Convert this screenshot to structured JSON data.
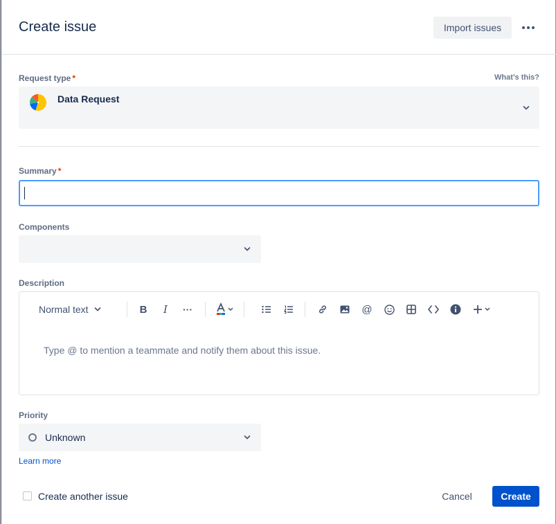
{
  "header": {
    "title": "Create issue",
    "import_label": "Import issues"
  },
  "request_type": {
    "label": "Request type",
    "required": "*",
    "help_link": "What’s this?",
    "value": "Data Request",
    "icon": "pie-chart-icon"
  },
  "summary": {
    "label": "Summary",
    "required": "*",
    "value": ""
  },
  "components": {
    "label": "Components",
    "value": ""
  },
  "description": {
    "label": "Description",
    "text_style": "Normal text",
    "placeholder": "Type @ to mention a teammate and notify them about this issue.",
    "toolbar_icons": [
      "bold-icon",
      "italic-icon",
      "more-formatting-icon",
      "text-color-icon",
      "bullet-list-icon",
      "numbered-list-icon",
      "link-icon",
      "image-icon",
      "mention-icon",
      "emoji-icon",
      "table-icon",
      "code-icon",
      "info-icon",
      "insert-plus-icon"
    ]
  },
  "priority": {
    "label": "Priority",
    "value": "Unknown",
    "learn_more": "Learn more"
  },
  "footer": {
    "create_another": "Create another issue",
    "cancel": "Cancel",
    "create": "Create"
  },
  "colors": {
    "primary": "#0052cc",
    "focus": "#4c9aff",
    "required": "#de350b",
    "field_bg": "#f4f5f7"
  }
}
